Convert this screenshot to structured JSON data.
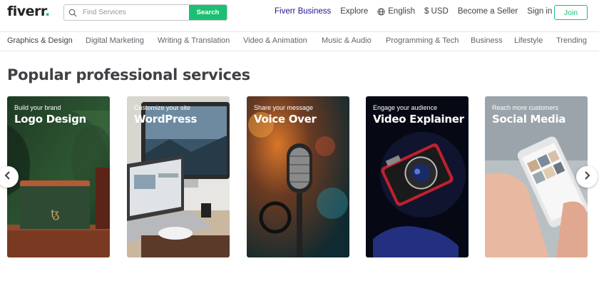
{
  "header": {
    "logo_text": "fiverr",
    "logo_dot": ".",
    "search": {
      "placeholder": "Find Services",
      "button_label": "Search"
    },
    "nav": {
      "fiverr_business": "Fiverr Business",
      "explore": "Explore",
      "language": "English",
      "currency": "$ USD",
      "become_seller": "Become a Seller",
      "sign_in": "Sign in",
      "join": "Join"
    }
  },
  "categories": [
    "Graphics & Design",
    "Digital Marketing",
    "Writing & Translation",
    "Video & Animation",
    "Music & Audio",
    "Programming & Tech",
    "Business",
    "Lifestyle",
    "Trending"
  ],
  "section": {
    "title": "Popular professional services"
  },
  "cards": [
    {
      "subtitle": "Build your brand",
      "title": "Logo Design"
    },
    {
      "subtitle": "Customize your site",
      "title": "WordPress"
    },
    {
      "subtitle": "Share your message",
      "title": "Voice Over"
    },
    {
      "subtitle": "Engage your audience",
      "title": "Video Explainer"
    },
    {
      "subtitle": "Reach more customers",
      "title": "Social Media"
    }
  ],
  "colors": {
    "brand_green": "#1dbf73",
    "business_blue": "#1e1692",
    "text": "#404145"
  },
  "icons": {
    "search": "search-icon",
    "language": "globe-icon",
    "prev": "chevron-left-icon",
    "next": "chevron-right-icon"
  }
}
